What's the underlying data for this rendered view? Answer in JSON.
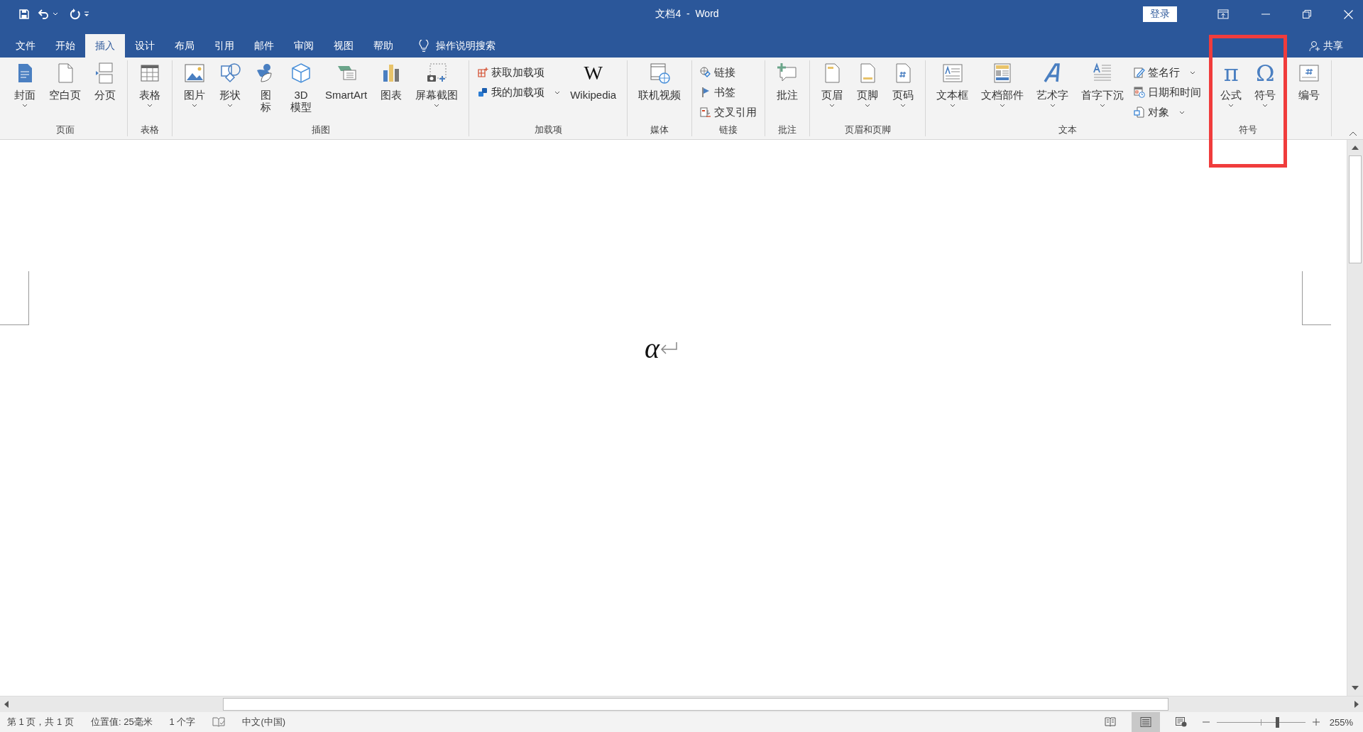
{
  "title_bar": {
    "title": "文档4  -  Word",
    "login": "登录"
  },
  "tabs": [
    {
      "label": "文件",
      "selected": false
    },
    {
      "label": "开始",
      "selected": false
    },
    {
      "label": "插入",
      "selected": true
    },
    {
      "label": "设计",
      "selected": false
    },
    {
      "label": "布局",
      "selected": false
    },
    {
      "label": "引用",
      "selected": false
    },
    {
      "label": "邮件",
      "selected": false
    },
    {
      "label": "审阅",
      "selected": false
    },
    {
      "label": "视图",
      "selected": false
    },
    {
      "label": "帮助",
      "selected": false
    }
  ],
  "tell_me": {
    "placeholder": "操作说明搜索"
  },
  "share": "共享",
  "ribbon": [
    {
      "name": "页面",
      "items": [
        {
          "kind": "large",
          "label": "封面",
          "dropdown": true
        },
        {
          "kind": "large",
          "label": "空白页",
          "dropdown": false
        },
        {
          "kind": "large",
          "label": "分页",
          "dropdown": false
        }
      ]
    },
    {
      "name": "表格",
      "items": [
        {
          "kind": "large",
          "label": "表格",
          "dropdown": true
        }
      ]
    },
    {
      "name": "插图",
      "items": [
        {
          "kind": "large",
          "label": "图片",
          "dropdown": true
        },
        {
          "kind": "large",
          "label": "形状",
          "dropdown": true
        },
        {
          "kind": "large",
          "label": "图标",
          "wrap": true,
          "dropdown": false
        },
        {
          "kind": "large",
          "label": "3D\n模型",
          "dropdown": false
        },
        {
          "kind": "large",
          "label": "SmartArt",
          "dropdown": false
        },
        {
          "kind": "large",
          "label": "图表",
          "dropdown": false
        },
        {
          "kind": "large",
          "label": "屏幕截图",
          "dropdown": true
        }
      ]
    },
    {
      "name": "加载项",
      "items": [
        {
          "kind": "stack",
          "items": [
            {
              "label": "获取加载项",
              "dropdown": false
            },
            {
              "label": "我的加载项",
              "dropdown": true
            }
          ]
        },
        {
          "kind": "wordmark",
          "glyph": "W",
          "label": "Wikipedia",
          "dropdown": false
        }
      ]
    },
    {
      "name": "媒体",
      "items": [
        {
          "kind": "large",
          "label": "联机视频",
          "dropdown": false
        }
      ]
    },
    {
      "name": "链接",
      "items": [
        {
          "kind": "stack",
          "items": [
            {
              "label": "链接",
              "dropdown": false
            },
            {
              "label": "书签",
              "dropdown": false
            },
            {
              "label": "交叉引用",
              "dropdown": false
            }
          ]
        }
      ]
    },
    {
      "name": "批注",
      "items": [
        {
          "kind": "large",
          "label": "批注",
          "dropdown": false
        }
      ]
    },
    {
      "name": "页眉和页脚",
      "items": [
        {
          "kind": "large",
          "label": "页眉",
          "dropdown": true
        },
        {
          "kind": "large",
          "label": "页脚",
          "dropdown": true
        },
        {
          "kind": "large",
          "label": "页码",
          "dropdown": true
        }
      ]
    },
    {
      "name": "文本",
      "items": [
        {
          "kind": "large",
          "label": "文本框",
          "dropdown": true
        },
        {
          "kind": "large",
          "label": "文档部件",
          "dropdown": true
        },
        {
          "kind": "large",
          "label": "艺术字",
          "dropdown": true
        },
        {
          "kind": "large",
          "label": "首字下沉",
          "dropdown": true
        },
        {
          "kind": "stack",
          "items": [
            {
              "label": "签名行",
              "dropdown": true
            },
            {
              "label": "日期和时间",
              "dropdown": false
            },
            {
              "label": "对象",
              "dropdown": true
            }
          ]
        }
      ]
    },
    {
      "name": "符号",
      "highlighted": true,
      "items": [
        {
          "kind": "symbol",
          "glyph": "π",
          "label": "公式",
          "dropdown": true
        },
        {
          "kind": "symbol",
          "glyph": "Ω",
          "label": "符号",
          "dropdown": true
        }
      ]
    },
    {
      "items": [
        {
          "kind": "large",
          "label": "编号",
          "dropdown": false
        }
      ]
    }
  ],
  "document": {
    "text": "α"
  },
  "status_bar": {
    "items": [
      "第 1 页，共 1 页",
      "位置值: 25毫米",
      "1 个字"
    ],
    "language": "中文(中国)",
    "views": [
      {
        "selected": false
      },
      {
        "selected": true
      },
      {
        "selected": false
      }
    ],
    "zoom": {
      "level": 0.68,
      "reading": "255%"
    }
  }
}
